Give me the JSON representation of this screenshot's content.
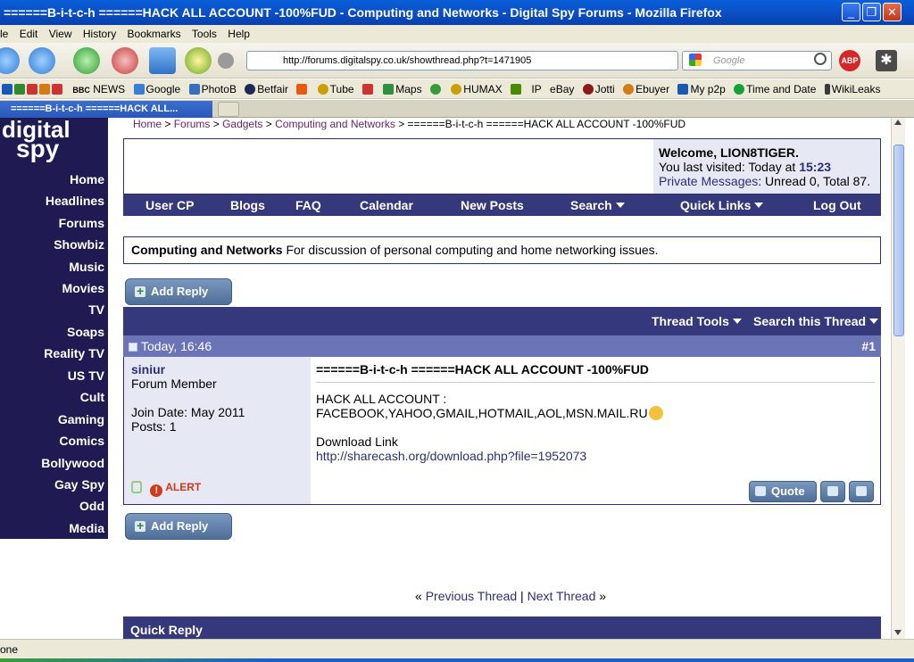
{
  "window": {
    "title": "======B-i-t-c-h ======HACK ALL ACCOUNT -100%FUD - Computing and Networks - Digital Spy Forums - Mozilla Firefox",
    "min": "_",
    "max": "❐",
    "close": "✕"
  },
  "menu": [
    "le",
    "Edit",
    "View",
    "History",
    "Bookmarks",
    "Tools",
    "Help"
  ],
  "url": "http://forums.digitalspy.co.uk/showthread.php?t=1471905",
  "url_site_badge": "ds",
  "search_placeholder": "Google",
  "bookmarks": [
    {
      "label": "NEWS",
      "prefix": "BBC",
      "color": "#b00000"
    },
    {
      "label": "Google",
      "color": "#3a7fd6"
    },
    {
      "label": "PhotoB",
      "color": "#3b6dbf"
    },
    {
      "label": "Betfair",
      "color": "#1d2a55"
    },
    {
      "label": "Tube",
      "color": "#c93"
    },
    {
      "label": "Maps",
      "color": "#2f8f3e"
    },
    {
      "label": "HUMAX",
      "color": "#3a8f3a"
    },
    {
      "label": "IP",
      "color": "#b0a000"
    },
    {
      "label": "eBay",
      "color": "#e04040"
    },
    {
      "label": "Jotti",
      "color": "#8b1b1b"
    },
    {
      "label": "Ebuyer",
      "color": "#d27b17"
    },
    {
      "label": "My p2p",
      "color": "#1a58b8"
    },
    {
      "label": "Time and Date",
      "color": "#18a038"
    },
    {
      "label": "WikiLeaks",
      "color": "#3a3a3a"
    }
  ],
  "tab": {
    "label": "======B-i-t-c-h ======HACK ALL..."
  },
  "sidebar": {
    "logo_line1": "digital",
    "logo_line2": "spy",
    "items": [
      "Home",
      "Headlines",
      "Forums",
      "Showbiz",
      "Music",
      "Movies",
      "TV",
      "Soaps",
      "Reality TV",
      "US TV",
      "Cult",
      "Gaming",
      "Comics",
      "Bollywood",
      "Gay Spy",
      "Odd",
      "Media"
    ]
  },
  "breadcrumb": {
    "home": "Home",
    "forums": "Forums",
    "gadgets": "Gadgets",
    "computing": "Computing and Networks",
    "current": "======B-i-t-c-h ======HACK ALL ACCOUNT -100%FUD",
    "sep": " > "
  },
  "welcome": {
    "greeting": "Welcome, LION8TIGER.",
    "last_visited_label": "You last visited: Today at",
    "last_visited_time": "15:23",
    "pm_label": "Private Messages",
    "pm_counts": ": Unread 0, Total 87."
  },
  "navmenu": [
    "User CP",
    "Blogs",
    "FAQ",
    "Calendar",
    "New Posts",
    "Search",
    "Quick Links",
    "Log Out"
  ],
  "forum": {
    "name": "Computing and Networks",
    "description": "For discussion of personal computing and home networking issues."
  },
  "add_reply_label": "Add Reply",
  "thread_tools": "Thread Tools",
  "search_thread": "Search this Thread",
  "post": {
    "date": "Today, 16:46",
    "number": "#1",
    "username": "siniur",
    "user_title": "Forum Member",
    "join_date": "Join Date: May 2011",
    "posts": "Posts: 1",
    "alert": "ALERT",
    "title": "======B-i-t-c-h ======HACK ALL ACCOUNT -100%FUD",
    "line1": "HACK ALL ACCOUNT :",
    "line2": "FACEBOOK,YAHOO,GMAIL,HOTMAIL,AOL,MSN.MAIL.RU",
    "download_label": "Download Link",
    "download_link": "http://sharecash.org/download.php?file=1952073",
    "quote_label": "Quote"
  },
  "prev_thread": "Previous Thread",
  "next_thread": "Next Thread",
  "quick_reply": "Quick Reply",
  "status": "one"
}
